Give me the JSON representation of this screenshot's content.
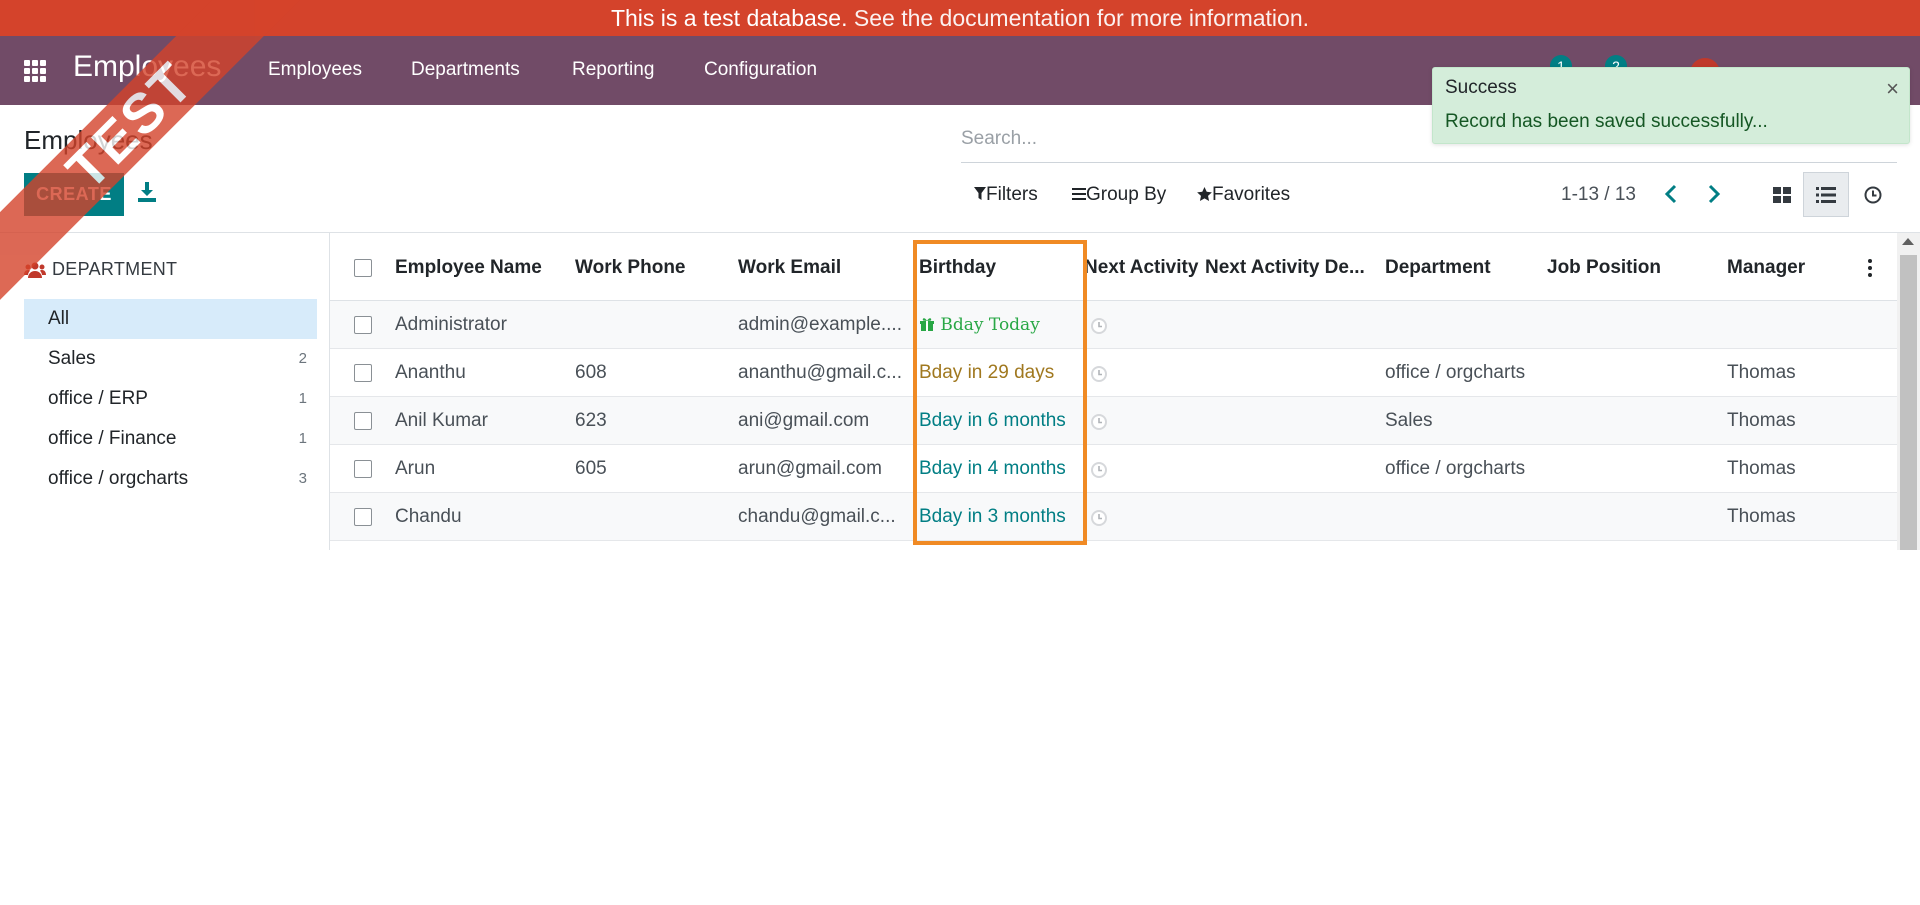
{
  "banner": {
    "text_main": "This is a test database.",
    "text_link": "See the documentation for more information."
  },
  "navbar": {
    "brand": "Employees",
    "menus": [
      "Employees",
      "Departments",
      "Reporting",
      "Configuration"
    ],
    "badges": [
      "1",
      "2"
    ]
  },
  "control_panel": {
    "title": "Employees",
    "create_label": "CREATE",
    "search_placeholder": "Search...",
    "filters_label": "Filters",
    "groupby_label": "Group By",
    "favorites_label": "Favorites",
    "pager": "1-13 / 13"
  },
  "sidebar": {
    "heading": "DEPARTMENT",
    "items": [
      {
        "label": "All",
        "count": ""
      },
      {
        "label": "Sales",
        "count": "2"
      },
      {
        "label": "office / ERP",
        "count": "1"
      },
      {
        "label": "office / Finance",
        "count": "1"
      },
      {
        "label": "office / orgcharts",
        "count": "3"
      }
    ]
  },
  "table": {
    "columns": [
      "Employee Name",
      "Work Phone",
      "Work Email",
      "Birthday",
      "Next Activity",
      "Next Activity De...",
      "Department",
      "Job Position",
      "Manager"
    ],
    "rows": [
      {
        "name": "Administrator",
        "phone": "",
        "email": "admin@example....",
        "birthday": "Bday Today",
        "department": "",
        "job": "",
        "manager": ""
      },
      {
        "name": "Ananthu",
        "phone": "608",
        "email": "ananthu@gmail.c...",
        "birthday": "Bday in 29 days",
        "department": "office / orgcharts",
        "job": "",
        "manager": "Thomas"
      },
      {
        "name": "Anil Kumar",
        "phone": "623",
        "email": "ani@gmail.com",
        "birthday": "Bday in 6 months",
        "department": "Sales",
        "job": "",
        "manager": "Thomas"
      },
      {
        "name": "Arun",
        "phone": "605",
        "email": "arun@gmail.com",
        "birthday": "Bday in 4 months",
        "department": "office / orgcharts",
        "job": "",
        "manager": "Thomas"
      },
      {
        "name": "Chandu",
        "phone": "",
        "email": "chandu@gmail.c...",
        "birthday": "Bday in 3 months",
        "department": "",
        "job": "",
        "manager": "Thomas"
      }
    ]
  },
  "toast": {
    "title": "Success",
    "message": "Record has been saved successfully...",
    "close": "×"
  },
  "ribbon": {
    "text": "TEST"
  },
  "colors": {
    "navbar": "#714b67",
    "banner": "#d4432b",
    "primary": "#017e84",
    "toast_bg": "#d4edda",
    "highlight": "#f08a24"
  },
  "icons": [
    "apps-grid-icon",
    "download-icon",
    "filter-icon",
    "group-by-icon",
    "star-icon",
    "chevron-left-icon",
    "chevron-right-icon",
    "kanban-view-icon",
    "list-view-icon",
    "activity-view-icon",
    "users-icon",
    "gift-icon",
    "clock-icon",
    "kebab-menu-icon",
    "close-icon"
  ]
}
